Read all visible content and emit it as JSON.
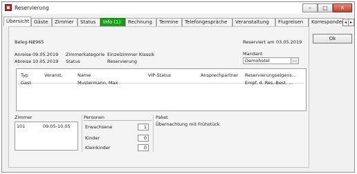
{
  "window": {
    "title": "Reservierung"
  },
  "tabs": [
    {
      "label": "Übersicht",
      "active": true
    },
    {
      "label": "Gäste"
    },
    {
      "label": "Zimmer"
    },
    {
      "label": "Status"
    },
    {
      "label": "Info (1)",
      "highlight_color": "#18a018"
    },
    {
      "label": "Rechnung"
    },
    {
      "label": "Termine"
    },
    {
      "label": "Telefongespräche"
    },
    {
      "label": "Veranstaltung"
    },
    {
      "label": "Flugreisen"
    },
    {
      "label": "Korrespondenz"
    }
  ],
  "header": {
    "beleg_label": "Beleg-Nr.",
    "beleg_value": "2965",
    "reserviert_label": "Reserviert am",
    "reserviert_value": "03.05.2019",
    "anreise_label": "Anreise",
    "anreise_value": "09.05.2019",
    "abreise_label": "Abreise",
    "abreise_value": "10.05.2019",
    "zimmerkategorie_label": "Zimmerkategorie",
    "zimmerkategorie_value": "Einzelzimmer Klassik",
    "status_label": "Status",
    "status_value": "Reservierung",
    "mandant_label": "Mandant",
    "mandant_value": "Demohotel",
    "mandant_button": "..."
  },
  "guest_table": {
    "columns": [
      "Typ",
      "Veranst.",
      "Name",
      "VIP-Status",
      "Ansprechpartner",
      "Reservierungseigens..."
    ],
    "rows": [
      [
        "Gast",
        "",
        "Mustermann, Max",
        "",
        "",
        "Empf. d. Res.-Best. ..."
      ]
    ]
  },
  "zimmer": {
    "title": "Zimmer",
    "number": "101",
    "dates": "09.05-10.05"
  },
  "personen": {
    "title": "Personen",
    "erwachsene_label": "Erwachsene",
    "erwachsene_value": "1",
    "kinder_label": "Kinder",
    "kinder_value": "0",
    "kleinkinder_label": "Kleinkinder",
    "kleinkinder_value": "0"
  },
  "paket": {
    "title": "Paket",
    "value": "Übernachtung mit Frühstück"
  },
  "buttons": {
    "ok": "Ok"
  },
  "window_controls": {
    "minimize": "–",
    "maximize": "□",
    "close": "✕"
  },
  "tab_scroll": {
    "left": "◂",
    "right": "▸"
  }
}
